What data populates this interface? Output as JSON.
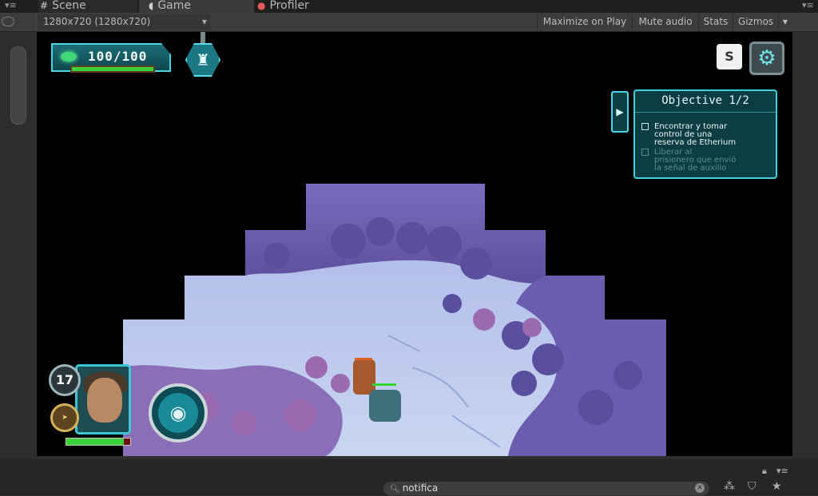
{
  "tabs": [
    {
      "label": "Scene",
      "icon": "grid-icon"
    },
    {
      "label": "Game",
      "icon": "pacman-icon"
    },
    {
      "label": "Profiler",
      "icon": "profiler-icon"
    }
  ],
  "toolbar": {
    "resolution": "1280x720 (1280x720)",
    "buttons": [
      "Maximize on Play",
      "Mute audio",
      "Stats",
      "Gizmos"
    ]
  },
  "hud": {
    "hp_text": "100/100",
    "hp_fraction": 1.0,
    "skip_label": "S",
    "level": "17",
    "portrait_hp_fraction": 0.9
  },
  "objective": {
    "title": "Objective 1/2",
    "items": [
      {
        "text": "Encontrar y tomar\ncontrol de una\nreserva de Etherium",
        "done": false
      },
      {
        "text": "Liberar al\nprisionero que envió\nla señal de auxilio",
        "done": true
      }
    ]
  },
  "search": {
    "value": "notifica"
  },
  "colors": {
    "accent": "#44d6e4",
    "hp_green": "#3bd13a",
    "editor_bg": "#2f2f2f"
  }
}
